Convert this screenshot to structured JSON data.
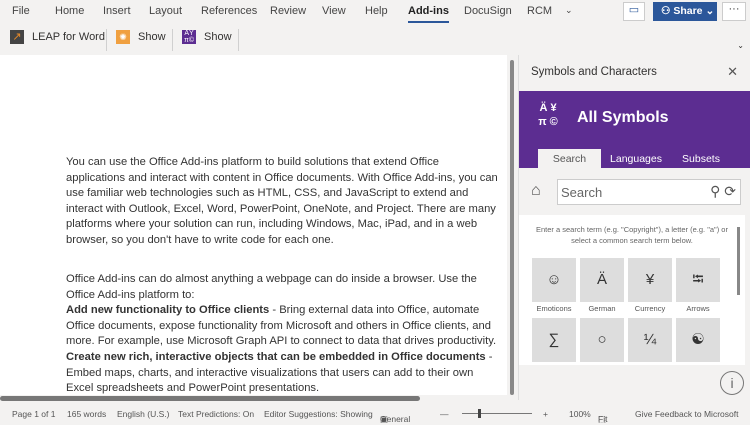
{
  "tabs": [
    "File",
    "Home",
    "Insert",
    "Layout",
    "References",
    "Review",
    "View",
    "Help",
    "Add-ins",
    "DocuSign",
    "RCM"
  ],
  "share_label": "Share",
  "ribbon": {
    "leap": "LEAP for Word",
    "show1": "Show",
    "show2": "Show"
  },
  "document": {
    "paragraphs": [
      "You can use the Office Add-ins platform to build solutions that extend Office applications and interact with content in Office documents. With Office Add-ins, you can use familiar web technologies such as HTML, CSS, and JavaScript to extend and interact with Outlook, Excel, Word, PowerPoint, OneNote, and Project. There are many platforms where your solution can run, including Windows, Mac, iPad, and in a web browser, so you don't have to write code for each one.",
      "Office Add-ins can do almost anything a webpage can do inside a browser. Use the Office Add-ins platform to:"
    ],
    "bullet1_bold": "Add new functionality to Office clients",
    "bullet1_text": " - Bring external data into Office, automate Office documents, expose functionality from Microsoft and others in Office clients, and more. For example, use Microsoft Graph API to connect to data that drives productivity.",
    "bullet2_bold": "Create new rich, interactive objects that can be embedded in Office documents",
    "bullet2_text": " - Embed maps, charts, and interactive visualizations that users can add to their own Excel spreadsheets and PowerPoint presentations."
  },
  "pane": {
    "title": "Symbols and Characters",
    "logo": "Ä ¥ π ©",
    "heading": "All Symbols",
    "tabs": [
      "Search",
      "Languages",
      "Subsets"
    ],
    "search_placeholder": "Search",
    "hint": "Enter a search term (e.g. \"Copyright\"), a letter (e.g. \"a\") or select a common search term below.",
    "tiles": [
      {
        "glyph": "☺",
        "label": "Emoticons"
      },
      {
        "glyph": "Ä",
        "label": "German"
      },
      {
        "glyph": "¥",
        "label": "Currency"
      },
      {
        "glyph": "⭾",
        "label": "Arrows"
      },
      {
        "glyph": "∑",
        "label": ""
      },
      {
        "glyph": "○",
        "label": ""
      },
      {
        "glyph": "¼",
        "label": ""
      },
      {
        "glyph": "☯",
        "label": ""
      }
    ]
  },
  "status": {
    "page": "Page 1 of 1",
    "words": "165 words",
    "lang": "English (U.S.)",
    "pred": "Text Predictions: On",
    "editor": "Editor Suggestions: Showing",
    "general": "General",
    "zoom": "100%",
    "fit": "Fit",
    "feedback": "Give Feedback to Microsoft"
  }
}
